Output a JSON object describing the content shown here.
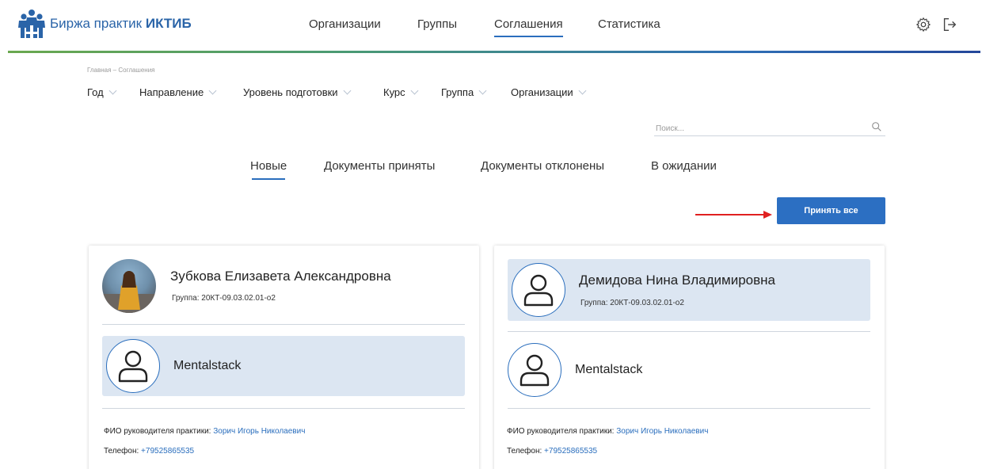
{
  "app": {
    "brand_prefix": "Биржа практик",
    "brand_bold": "ИКТИБ"
  },
  "nav": {
    "items": [
      "Организации",
      "Группы",
      "Соглашения",
      "Статистика"
    ],
    "active_index": 2
  },
  "header_icons": [
    "gear-icon",
    "logout-icon"
  ],
  "breadcrumb": "Главная – Соглашения",
  "filters": [
    "Год",
    "Направление",
    "Уровень подготовки",
    "Курс",
    "Группа",
    "Организации"
  ],
  "search": {
    "placeholder": "Поиск...",
    "value": ""
  },
  "tabs": [
    "Новые",
    "Документы приняты",
    "Документы отклонены",
    "В ожидании"
  ],
  "active_tab_index": 0,
  "accept_all_label": "Принять все",
  "cards": [
    {
      "student_name": "Зубкова Елизавета Александровна",
      "group": "Группа: 20КТ-09.03.02.01-о2",
      "organization": "Mentalstack",
      "supervisor_label": "ФИО руководителя практики:",
      "supervisor": "Зорич Игорь Николаевич",
      "phone_label": "Телефон:",
      "phone": "+79525865535",
      "highlighted": "organization"
    },
    {
      "student_name": "Демидова Нина Владимировна",
      "group": "Группа: 20КТ-09.03.02.01-о2",
      "organization": "Mentalstack",
      "supervisor_label": "ФИО руководителя практики:",
      "supervisor": "Зорич Игорь Николаевич",
      "phone_label": "Телефон:",
      "phone": "+79525865535",
      "highlighted": "student"
    }
  ],
  "colors": {
    "accent": "#2c6fc2",
    "highlight_bg": "#dce6f2",
    "link": "#2a6ebd",
    "arrow": "#e02020"
  }
}
